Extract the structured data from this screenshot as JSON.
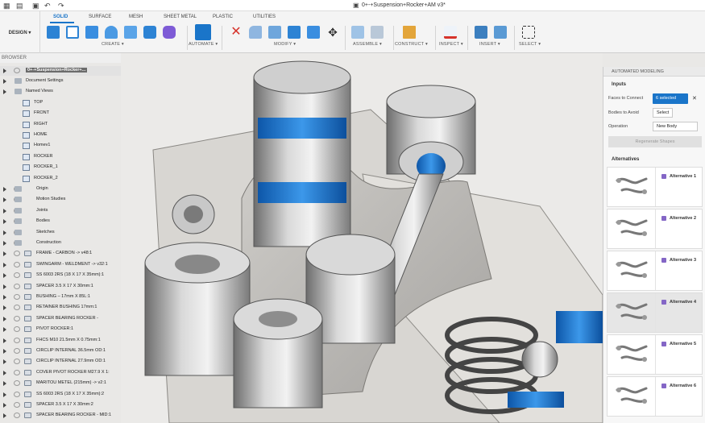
{
  "titlebar": {
    "document_title": "0+-+Suspension+Rocker+AM v3*"
  },
  "workspace": {
    "label": "DESIGN ▾"
  },
  "tabs": [
    "SOLID",
    "SURFACE",
    "MESH",
    "SHEET METAL",
    "PLASTIC",
    "UTILITIES"
  ],
  "toolbar": {
    "groups": [
      {
        "label": "CREATE ▾"
      },
      {
        "label": "AUTOMATE ▾"
      },
      {
        "label": "MODIFY ▾"
      },
      {
        "label": "ASSEMBLE ▾"
      },
      {
        "label": "CONSTRUCT ▾"
      },
      {
        "label": "INSPECT ▾"
      },
      {
        "label": "INSERT ▾"
      },
      {
        "label": "SELECT ▾"
      }
    ]
  },
  "browser": {
    "header": "BROWSER",
    "root": "0+-+Suspension+Rocker+...",
    "items": [
      {
        "label": "Document Settings",
        "kind": "folder"
      },
      {
        "label": "Named Views",
        "kind": "folder"
      },
      {
        "label": "TOP",
        "kind": "view"
      },
      {
        "label": "FRONT",
        "kind": "view"
      },
      {
        "label": "RIGHT",
        "kind": "view"
      },
      {
        "label": "HOME",
        "kind": "view"
      },
      {
        "label": "Homev1",
        "kind": "view"
      },
      {
        "label": "ROCKER",
        "kind": "view"
      },
      {
        "label": "ROCKER_1",
        "kind": "view"
      },
      {
        "label": "ROCKER_2",
        "kind": "view"
      },
      {
        "label": "Origin",
        "kind": "folder"
      },
      {
        "label": "Motion Studies",
        "kind": "folder"
      },
      {
        "label": "Joints",
        "kind": "folder"
      },
      {
        "label": "Bodies",
        "kind": "folder"
      },
      {
        "label": "Sketches",
        "kind": "folder"
      },
      {
        "label": "Construction",
        "kind": "folder"
      },
      {
        "label": "FRAME - CARBON -> v48:1",
        "kind": "comp"
      },
      {
        "label": "SWINGARM - WELDMENT -> v32:1",
        "kind": "comp"
      },
      {
        "label": "SS 6003 2RS (18 X 17 X 35mm):1",
        "kind": "comp"
      },
      {
        "label": "SPACER 3.5 X 17 X 30mm:1",
        "kind": "comp"
      },
      {
        "label": "BUSHING – 17mm X 85L:1",
        "kind": "comp"
      },
      {
        "label": "RETAINER BUSHING 17mm:1",
        "kind": "comp"
      },
      {
        "label": "SPACER BEARING ROCKER -",
        "kind": "comp"
      },
      {
        "label": "PIVOT ROCKER:1",
        "kind": "comp"
      },
      {
        "label": "FHCS M10 21.5mm X 0.75mm:1",
        "kind": "comp"
      },
      {
        "label": "CIRCLIP INTERNAL 36.5mm OD:1",
        "kind": "comp"
      },
      {
        "label": "CIRCLIP INTERNAL 27.9mm OD:1",
        "kind": "comp"
      },
      {
        "label": "COVER PIVOT ROCKER M27.9 X 1:",
        "kind": "comp"
      },
      {
        "label": "MARITOU METEL (215mm) -> v2:1",
        "kind": "comp"
      },
      {
        "label": "SS 6003 2RS (18 X 17 X 35mm):2",
        "kind": "comp"
      },
      {
        "label": "SPACER 3.5 X 17 X 30mm:2",
        "kind": "comp"
      },
      {
        "label": "SPACER BEARING ROCKER - MID:1",
        "kind": "comp"
      }
    ]
  },
  "panel": {
    "title": "AUTOMATED MODELING",
    "inputs_label": "Inputs",
    "faces_label": "Faces to Connect",
    "faces_value": "6 selected",
    "bodies_label": "Bodies to Avoid",
    "bodies_value": "Select",
    "operation_label": "Operation",
    "operation_value": "New Body",
    "regen_label": "Regenerate Shapes",
    "alternatives_label": "Alternatives",
    "alternatives": [
      "Alternative 1",
      "Alternative 2",
      "Alternative 3",
      "Alternative 4",
      "Alternative 5",
      "Alternative 6"
    ]
  },
  "colors": {
    "accent": "#1a75c9",
    "bushing_blue": "#1f7ad6"
  }
}
